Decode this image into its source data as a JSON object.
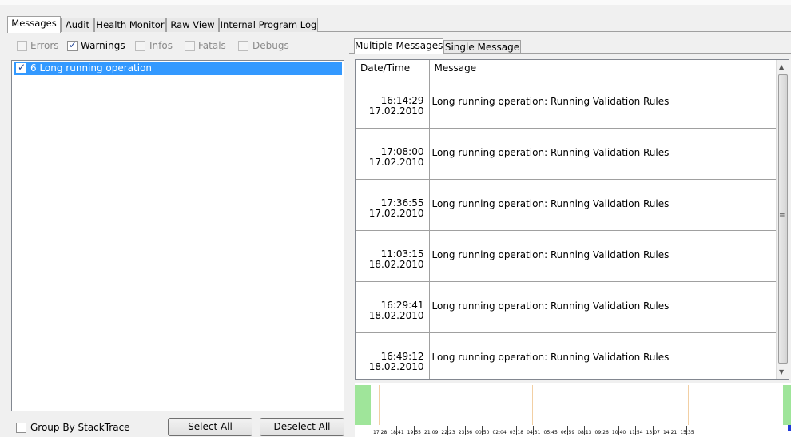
{
  "tabs": [
    {
      "label": "Messages",
      "active": true
    },
    {
      "label": "Audit",
      "active": false
    },
    {
      "label": "Health Monitor",
      "active": false
    },
    {
      "label": "Raw View",
      "active": false
    },
    {
      "label": "Internal Program Log",
      "active": false
    }
  ],
  "filters": [
    {
      "label": "Errors",
      "checked": false,
      "enabled": false
    },
    {
      "label": "Warnings",
      "checked": true,
      "enabled": true
    },
    {
      "label": "Infos",
      "checked": false,
      "enabled": false
    },
    {
      "label": "Fatals",
      "checked": false,
      "enabled": false
    },
    {
      "label": "Debugs",
      "checked": false,
      "enabled": false
    }
  ],
  "message_groups": [
    {
      "label": "6 Long running operation",
      "checked": true,
      "selected": true
    }
  ],
  "bottom": {
    "group_by_label": "Group By StackTrace",
    "group_by_checked": false,
    "select_all": "Select All",
    "deselect_all": "Deselect All"
  },
  "detail_tabs": [
    {
      "label": "Multiple Messages",
      "active": true
    },
    {
      "label": "Single Message",
      "active": false
    }
  ],
  "grid": {
    "columns": [
      "Date/Time",
      "Message"
    ],
    "rows": [
      {
        "time": "16:14:29",
        "date": "17.02.2010",
        "message": "Long running operation: Running Validation Rules"
      },
      {
        "time": "17:08:00",
        "date": "17.02.2010",
        "message": "Long running operation: Running Validation Rules"
      },
      {
        "time": "17:36:55",
        "date": "17.02.2010",
        "message": "Long running operation: Running Validation Rules"
      },
      {
        "time": "11:03:15",
        "date": "18.02.2010",
        "message": "Long running operation: Running Validation Rules"
      },
      {
        "time": "16:29:41",
        "date": "18.02.2010",
        "message": "Long running operation: Running Validation Rules"
      },
      {
        "time": "16:49:12",
        "date": "18.02.2010",
        "message": "Long running operation: Running Validation Rules"
      }
    ]
  },
  "timeline": {
    "labels": [
      "17:28",
      "18:41",
      "19:55",
      "21:09",
      "22:23",
      "23:36",
      "00:50",
      "02:04",
      "03:18",
      "04:31",
      "05:45",
      "06:59",
      "08:13",
      "09:26",
      "10:40",
      "11:54",
      "13:07",
      "14:21",
      "15:35"
    ],
    "colors": {
      "activity": "#9fe59a",
      "marker": "#f2cfa3",
      "cursor": "#1f39d8"
    }
  }
}
